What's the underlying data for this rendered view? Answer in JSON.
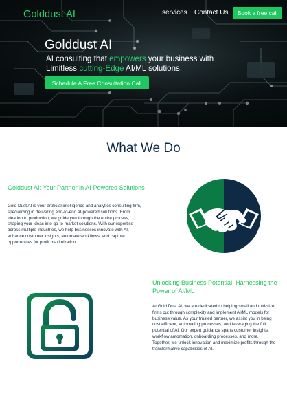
{
  "brand": {
    "name": "Golddust AI",
    "accent": "#22d46a",
    "navy": "#0e2a45"
  },
  "nav": {
    "services": "services",
    "contact": "Contact Us",
    "cta": "Book a free call"
  },
  "hero": {
    "title": "Golddust AI",
    "line1_pre": "AI consulting that ",
    "line1_hl": "empowers",
    "line1_post": " your business with",
    "line2_pre": "Limitless ",
    "line2_hl": "cutting-Edge",
    "line2_post": " AI/ML solutions.",
    "cta": "Schedule A Free Consultation Call"
  },
  "what_we_do": {
    "title": "What We Do",
    "items": [
      {
        "title": "Golddust AI: Your Partner in AI-Powered Solutions",
        "body": "Gold Dust AI is your artificial intelligence and analytics consulting firm, specializing in delivering end-to-end AI-powered solutions. From ideation to production, we guide you through the entire process, shaping your ideas into go-to-market solutions. With our expertise across multiple industries, we help businesses innovate with AI, enhance customer insights, automate workflows, and capture opportunities for profit maximization.",
        "icon": "handshake-icon"
      },
      {
        "title": "Unlocking Business Potential: Harnessing the Power of AI/ML",
        "body": "At Gold Dust AI, we are dedicated to helping small and mid-size firms cut through complexity and implement AI/ML models for business value. As your trusted partner, we assist you in being cost efficient, automating processes, and leveraging the full potential of AI. Our expert guidance spans customer insights, workflow automation, onboarding processes, and more. Together, we unlock innovation and maximize profits through the transformative capabilities of AI.",
        "icon": "unlock-icon"
      }
    ]
  }
}
